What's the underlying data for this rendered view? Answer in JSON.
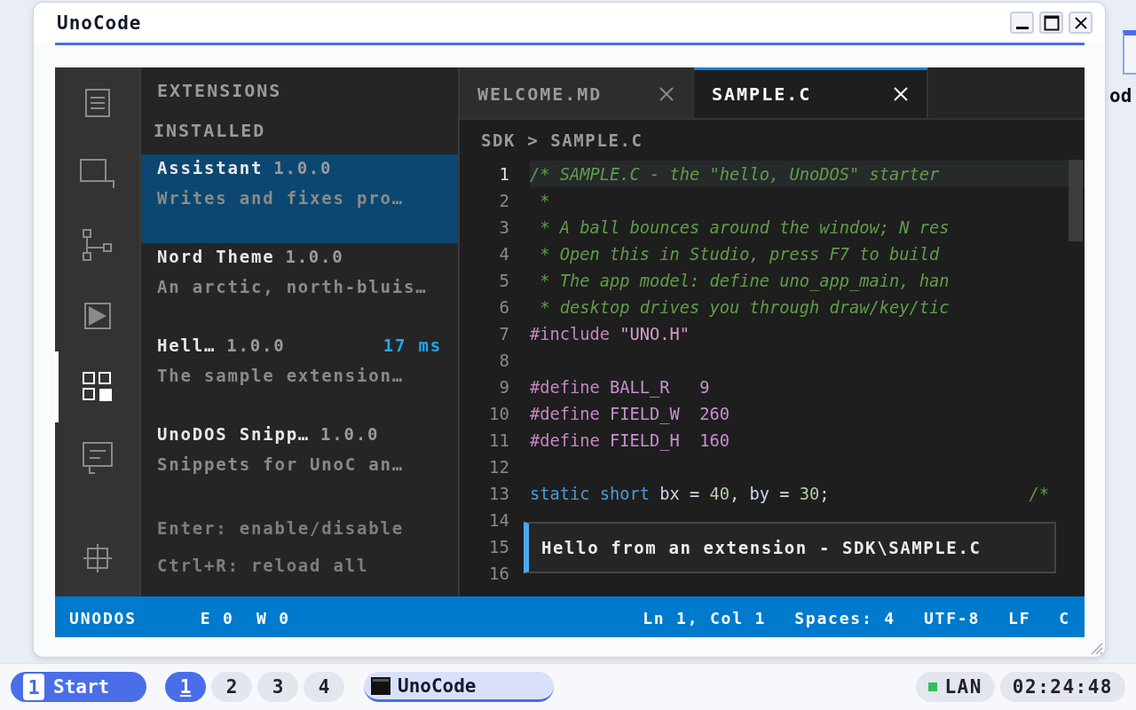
{
  "window": {
    "title": "UnoCode"
  },
  "desktop": {
    "icon_label": "od"
  },
  "activity_bar": [
    {
      "kind": "document",
      "selected": false
    },
    {
      "kind": "search",
      "selected": false
    },
    {
      "kind": "branch",
      "selected": false
    },
    {
      "kind": "run",
      "selected": false
    },
    {
      "kind": "extensions",
      "selected": true
    },
    {
      "kind": "chat",
      "selected": false
    },
    {
      "kind": "crosshair",
      "selected": false
    }
  ],
  "sidebar": {
    "title": "EXTENSIONS",
    "section": "INSTALLED",
    "extensions": [
      {
        "name": "Assistant",
        "version": "1.0.0",
        "description": "Writes and fixes pro…",
        "selected": true
      },
      {
        "name": "Nord Theme",
        "version": "1.0.0",
        "description": "An arctic, north-bluis…",
        "selected": false
      },
      {
        "name": "Hell…",
        "version": "1.0.0",
        "timing": "17 ms",
        "description": "The sample extension…",
        "selected": false
      },
      {
        "name": "UnoDOS Snipp…",
        "version": "1.0.0",
        "description": "Snippets for UnoC an…",
        "selected": false
      }
    ],
    "hints": [
      "Enter: enable/disable",
      "Ctrl+R: reload all"
    ]
  },
  "tabs": [
    {
      "label": "WELCOME.MD",
      "selected": false
    },
    {
      "label": "SAMPLE.C",
      "selected": true
    }
  ],
  "breadcrumb": "SDK > SAMPLE.C",
  "code": [
    {
      "number": "1",
      "current": true,
      "tokens": [
        {
          "kind": "comment",
          "text": "/* SAMPLE.C - the \"hello, UnoDOS\" starter"
        }
      ]
    },
    {
      "number": "2",
      "current": false,
      "tokens": [
        {
          "kind": "comment",
          "text": " *"
        }
      ]
    },
    {
      "number": "3",
      "current": false,
      "tokens": [
        {
          "kind": "comment",
          "text": " * A ball bounces around the window; N res"
        }
      ]
    },
    {
      "number": "4",
      "current": false,
      "tokens": [
        {
          "kind": "comment",
          "text": " * Open this in Studio, press F7 to build"
        }
      ]
    },
    {
      "number": "5",
      "current": false,
      "tokens": [
        {
          "kind": "comment",
          "text": " * The app model: define uno_app_main, han"
        }
      ]
    },
    {
      "number": "6",
      "current": false,
      "tokens": [
        {
          "kind": "comment",
          "text": " * desktop drives you through draw/key/tic"
        }
      ]
    },
    {
      "number": "7",
      "current": false,
      "tokens": [
        {
          "kind": "preproc",
          "text": "#include"
        },
        {
          "kind": "string",
          "text": " \"UNO.H\""
        }
      ]
    },
    {
      "number": "8",
      "current": false
    },
    {
      "number": "9",
      "current": false,
      "tokens": [
        {
          "kind": "preproc",
          "text": "#define"
        },
        {
          "kind": "macro",
          "text": " BALL_R   9"
        }
      ]
    },
    {
      "number": "10",
      "current": false,
      "tokens": [
        {
          "kind": "preproc",
          "text": "#define"
        },
        {
          "kind": "macro",
          "text": " FIELD_W  260"
        }
      ]
    },
    {
      "number": "11",
      "current": false,
      "tokens": [
        {
          "kind": "preproc",
          "text": "#define"
        },
        {
          "kind": "macro",
          "text": " FIELD_H  160"
        }
      ]
    },
    {
      "number": "12",
      "current": false
    },
    {
      "number": "13",
      "current": false,
      "tokens": [
        {
          "kind": "keyword",
          "text": "static short"
        },
        {
          "kind": "ident",
          "text": " bx = "
        },
        {
          "kind": "number",
          "text": "40"
        },
        {
          "kind": "ident",
          "text": ", by = "
        },
        {
          "kind": "number",
          "text": "30"
        },
        {
          "kind": "ident",
          "text": ";                    "
        },
        {
          "kind": "comment",
          "text": "/*"
        }
      ]
    },
    {
      "number": "14",
      "current": false
    },
    {
      "number": "15",
      "current": false
    },
    {
      "number": "16",
      "current": false
    }
  ],
  "tooltip": "Hello from an extension - SDK\\SAMPLE.C",
  "status_bar": {
    "left": [
      "UNODOS",
      "E 0  W 0"
    ],
    "right": [
      "Ln 1, Col 1",
      "Spaces: 4",
      "UTF-8",
      "LF",
      "C"
    ]
  },
  "taskbar": {
    "start": {
      "badge": "1",
      "label": "Start"
    },
    "workspaces": [
      {
        "label": "1",
        "selected": true
      },
      {
        "label": "2",
        "selected": false
      },
      {
        "label": "3",
        "selected": false
      },
      {
        "label": "4",
        "selected": false
      }
    ],
    "tasks": [
      {
        "label": "UnoCode",
        "selected": true
      }
    ],
    "network": {
      "label": "LAN",
      "on": true
    },
    "clock": "02:24:48"
  }
}
